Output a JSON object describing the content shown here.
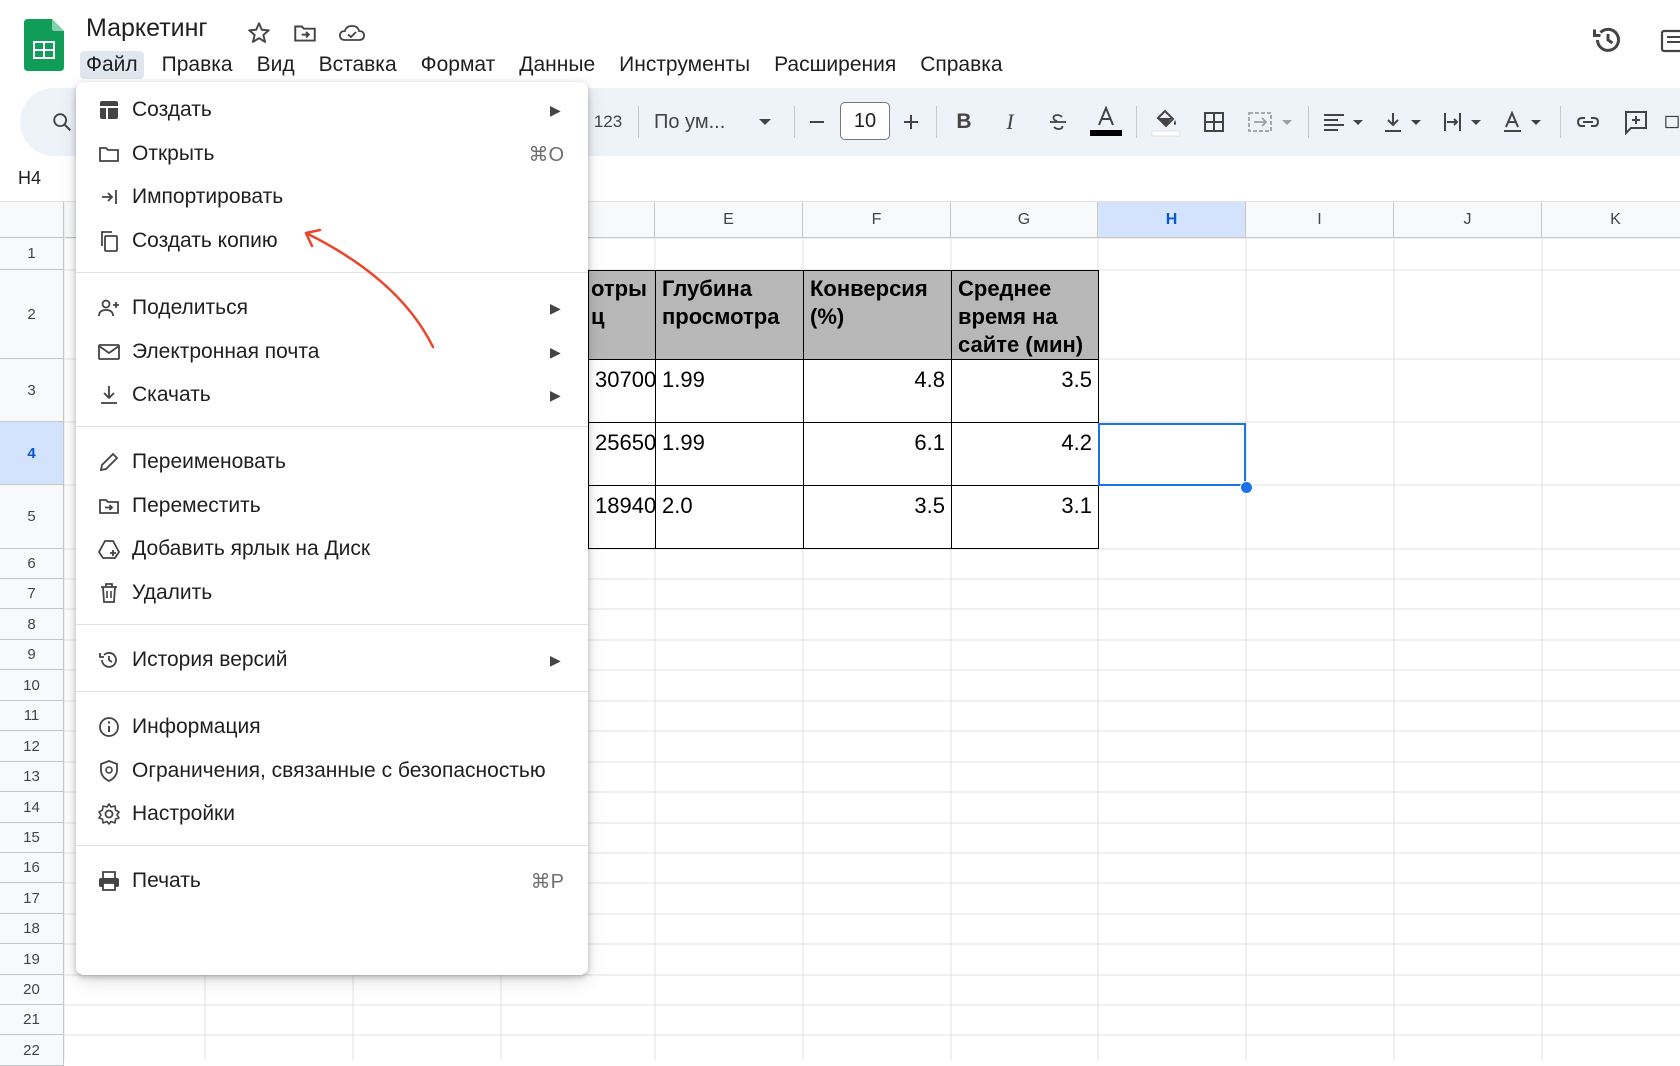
{
  "app": {
    "doc_title": "Маркетинг",
    "brand_color": "#0f9d58",
    "accent_color": "#1a73e8"
  },
  "menubar": {
    "items": [
      "Файл",
      "Правка",
      "Вид",
      "Вставка",
      "Формат",
      "Данные",
      "Инструменты",
      "Расширения",
      "Справка"
    ]
  },
  "toolbar": {
    "number_format": "123",
    "font": "По ум...",
    "font_size": "10",
    "bold": "B",
    "italic": "I"
  },
  "name_box": "H4",
  "columns": [
    "E",
    "F",
    "G",
    "H",
    "I",
    "J",
    "K"
  ],
  "rows": [
    "1",
    "2",
    "3",
    "4",
    "5",
    "6",
    "7",
    "8",
    "9",
    "10",
    "11",
    "12",
    "13",
    "14",
    "15",
    "16",
    "17",
    "18",
    "19",
    "20",
    "21",
    "22"
  ],
  "selected_cell": "H4",
  "table": {
    "partial_header": "отры\nц",
    "headers": {
      "E": "Глубина просмотра",
      "F": "Конверсия (%)",
      "G": "Среднее время на сайте (мин)"
    },
    "rows": [
      {
        "D": "30700",
        "E": "1.99",
        "F": "4.8",
        "G": "3.5"
      },
      {
        "D": "25650",
        "E": "1.99",
        "F": "6.1",
        "G": "4.2"
      },
      {
        "D": "18940",
        "E": "2.0",
        "F": "3.5",
        "G": "3.1"
      }
    ]
  },
  "file_menu": {
    "items": [
      {
        "label": "Создать",
        "icon": "create-icon",
        "submenu": true
      },
      {
        "label": "Открыть",
        "icon": "folder-icon",
        "shortcut": "⌘O"
      },
      {
        "label": "Импортировать",
        "icon": "import-icon"
      },
      {
        "label": "Создать копию",
        "icon": "copy-icon"
      },
      {
        "label": "Поделиться",
        "icon": "share-person-icon",
        "submenu": true
      },
      {
        "label": "Электронная почта",
        "icon": "mail-icon",
        "submenu": true
      },
      {
        "label": "Скачать",
        "icon": "download-icon",
        "submenu": true
      },
      {
        "label": "Переименовать",
        "icon": "pencil-icon"
      },
      {
        "label": "Переместить",
        "icon": "move-folder-icon"
      },
      {
        "label": "Добавить ярлык на Диск",
        "icon": "drive-shortcut-icon"
      },
      {
        "label": "Удалить",
        "icon": "trash-icon"
      },
      {
        "label": "История версий",
        "icon": "history-icon",
        "submenu": true
      },
      {
        "label": "Информация",
        "icon": "info-icon"
      },
      {
        "label": "Ограничения, связанные с безопасностью",
        "icon": "security-icon"
      },
      {
        "label": "Настройки",
        "icon": "settings-icon"
      },
      {
        "label": "Печать",
        "icon": "print-icon",
        "shortcut": "⌘P"
      }
    ]
  },
  "annotation_color": "#e8452c"
}
